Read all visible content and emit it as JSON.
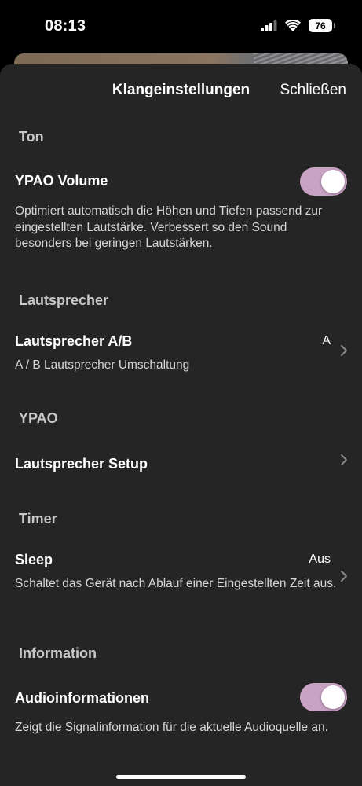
{
  "status_bar": {
    "time": "08:13",
    "battery_level": "76",
    "icons": [
      "signal-icon",
      "wifi-icon",
      "battery-icon"
    ]
  },
  "header": {
    "title": "Klangeinstellungen",
    "close_label": "Schließen"
  },
  "sections": {
    "ton": {
      "header": "Ton",
      "ypao_volume": {
        "title": "YPAO Volume",
        "enabled": true,
        "description": "Optimiert automatisch die Höhen und Tiefen passend zur eingestellten Lautstärke. Verbessert so den Sound besonders bei geringen Lautstärken."
      }
    },
    "lautsprecher": {
      "header": "Lautsprecher",
      "speaker_ab": {
        "title": "Lautsprecher A/B",
        "value": "A",
        "description": "A / B Lautsprecher Umschaltung"
      }
    },
    "ypao": {
      "header": "YPAO",
      "speaker_setup": {
        "title": "Lautsprecher Setup"
      }
    },
    "timer": {
      "header": "Timer",
      "sleep": {
        "title": "Sleep",
        "value": "Aus",
        "description": "Schaltet das Gerät nach Ablauf einer Eingestellten Zeit aus."
      }
    },
    "information": {
      "header": "Information",
      "audio_info": {
        "title": "Audioinformationen",
        "enabled": true,
        "description": "Zeigt die Signalinformation für die aktuelle Audioquelle an."
      }
    }
  },
  "colors": {
    "sheet_background": "#252525",
    "toggle_on": "#c9a3c4",
    "section_header": "#c8c8c8"
  }
}
